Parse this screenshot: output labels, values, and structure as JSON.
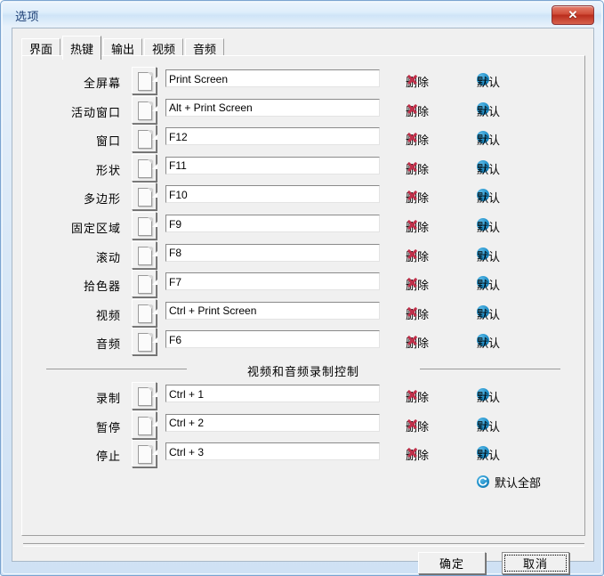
{
  "window": {
    "title": "选项",
    "close_label": "✕"
  },
  "tabs": [
    {
      "label": "界面",
      "active": false
    },
    {
      "label": "热键",
      "active": true
    },
    {
      "label": "输出",
      "active": false
    },
    {
      "label": "视频",
      "active": false
    },
    {
      "label": "音频",
      "active": false
    }
  ],
  "actions": {
    "delete_label": "删除",
    "default_label": "默认",
    "default_all_label": "默认全部"
  },
  "hotkeys": [
    {
      "label": "全屏幕",
      "value": "Print Screen"
    },
    {
      "label": "活动窗口",
      "value": "Alt + Print Screen"
    },
    {
      "label": "窗口",
      "value": "F12"
    },
    {
      "label": "形状",
      "value": "F11"
    },
    {
      "label": "多边形",
      "value": "F10"
    },
    {
      "label": "固定区域",
      "value": "F9"
    },
    {
      "label": "滚动",
      "value": "F8"
    },
    {
      "label": "拾色器",
      "value": "F7"
    },
    {
      "label": "视频",
      "value": "Ctrl + Print Screen"
    },
    {
      "label": "音频",
      "value": "F6"
    }
  ],
  "record_group": {
    "title": "视频和音频录制控制",
    "rows": [
      {
        "label": "录制",
        "value": "Ctrl + 1"
      },
      {
        "label": "暂停",
        "value": "Ctrl + 2"
      },
      {
        "label": "停止",
        "value": "Ctrl + 3"
      }
    ]
  },
  "footer": {
    "ok_label": "确定",
    "cancel_label": "取消"
  },
  "colors": {
    "delete_icon": "#c0304a",
    "default_icon": "#1f8fc9",
    "title_text": "#1c3f75",
    "close_button": "#cf4b37"
  }
}
